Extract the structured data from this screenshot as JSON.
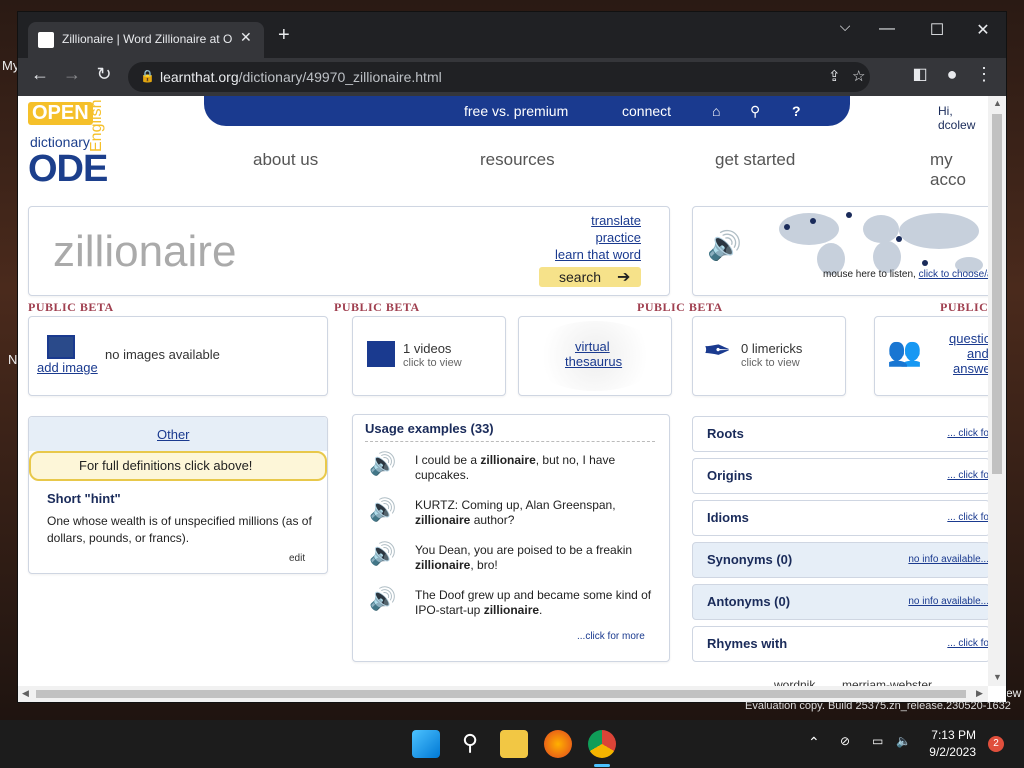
{
  "desktop": {
    "left_fragment_1": "My",
    "left_fragment_2": "N",
    "right_fragment": "ew",
    "eval_text": "Evaluation copy. Build 25375.zn_release.230520-1632"
  },
  "browser": {
    "tab_title": "Zillionaire | Word Zillionaire at Op",
    "tab_close": "✕",
    "new_tab": "+",
    "url_host": "learnthat.org",
    "url_path": "/dictionary/49970_zillionaire.html"
  },
  "site": {
    "logo_open": "OPEN",
    "logo_english": "English",
    "logo_dictionary": "dictionary",
    "logo_ode": "ODE",
    "topnav": {
      "free": "free vs. premium",
      "connect": "connect"
    },
    "hi_user": "Hi, dcolew",
    "mainnav": [
      "about us",
      "resources",
      "get started",
      "my acco"
    ]
  },
  "search": {
    "word": "zillionaire",
    "links": [
      "translate",
      "practice",
      "learn that word"
    ],
    "button": "search"
  },
  "map": {
    "hint": "mouse here to listen,",
    "hint_link": "click to choose/add"
  },
  "beta_label": "PUBLIC BETA",
  "beta_label_cut": "PUBLIC",
  "features": {
    "images": {
      "title": "no images available",
      "link": "add image"
    },
    "videos": {
      "title": "1 videos",
      "sub": "click to view"
    },
    "thesaurus": {
      "line1": "virtual",
      "line2": "thesaurus"
    },
    "limericks": {
      "title": "0 limericks",
      "sub": "click to view"
    },
    "qa": {
      "line1": "questio",
      "line2": "and",
      "line3": "answe"
    }
  },
  "definition": {
    "tab": "Other",
    "notice": "For full definitions click above!",
    "hint_title": "Short \"hint\"",
    "hint_text": "One whose wealth is of unspecified millions (as of dollars, pounds, or francs).",
    "edit": "edit"
  },
  "usage": {
    "title": "Usage examples (33)",
    "examples": [
      {
        "before": "I could be a ",
        "word": "zillionaire",
        "after": ", but no, I have cupcakes."
      },
      {
        "before": "KURTZ: Coming up, Alan Greenspan, ",
        "word": "zillionaire",
        "after": " author?"
      },
      {
        "before": "You Dean, you are poised to be a freakin ",
        "word": "zillionaire",
        "after": ", bro!"
      },
      {
        "before": "The Doof grew up and became some kind of IPO-start-up ",
        "word": "zillionaire",
        "after": "."
      }
    ],
    "more": "...click for more"
  },
  "sidebar": [
    {
      "label": "Roots",
      "link": "... click fo",
      "blue": false
    },
    {
      "label": "Origins",
      "link": "... click fo",
      "blue": false
    },
    {
      "label": "Idioms",
      "link": "... click fo",
      "blue": false
    },
    {
      "label": "Synonyms (0)",
      "link": "no info available...",
      "blue": true
    },
    {
      "label": "Antonyms (0)",
      "link": "no info available...",
      "blue": true
    },
    {
      "label": "Rhymes with",
      "link": "... click fo",
      "blue": false
    }
  ],
  "bottom_links": [
    "wordnik",
    "merriam-webster"
  ],
  "taskbar": {
    "time": "7:13 PM",
    "date": "9/2/2023",
    "notif_count": "2"
  }
}
